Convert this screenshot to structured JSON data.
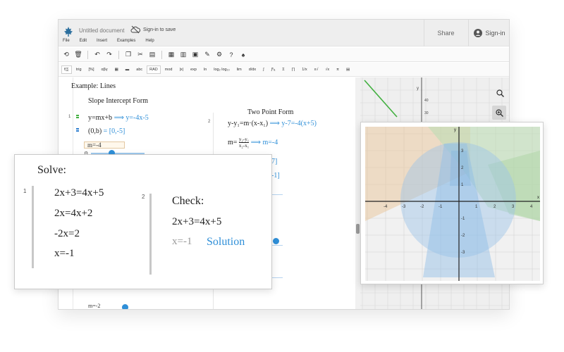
{
  "app": {
    "doc_title": "Untitled document",
    "signin_save": "Sign-in to save",
    "share": "Share",
    "signin": "Sign-in",
    "menu": [
      "File",
      "Edit",
      "Insert",
      "Examples",
      "Help"
    ],
    "math_toolbar": [
      "f|∑",
      "trig",
      "[%]",
      "αβγ",
      "abc",
      "RAD",
      "mod",
      "|x|",
      "exp",
      "ln",
      "log₂ log₁₀",
      "lim",
      "d/dx",
      "∫",
      "∫ᵇₐ",
      "Σ",
      "∏",
      "1/x",
      "x√",
      "√x",
      "π"
    ]
  },
  "sheet": {
    "example_title": "Example: Lines",
    "slope_heading": "Slope Intercept Form",
    "two_point_heading": "Two Point Form",
    "block1_number": "1",
    "block2_number": "2",
    "eq_slope": "y=mx+b",
    "eq_slope_result": "⟹ y=-4x-5",
    "eq_point": "(0,b)",
    "eq_point_result": "= [0,-5]",
    "m_value": "m=-4",
    "eq_two_point": "y-y₁=m·(x-x₁)",
    "eq_two_point_result": "⟹ y-7=-4(x+5)",
    "eq_m_formula_prefix": "m=",
    "eq_m_num": "y₂-y₁",
    "eq_m_den": "x₂-x₁",
    "eq_m_result": "⟹ m=-4",
    "partial_1": "7]",
    "partial_2": "-1]",
    "m_bottom": "m=-2"
  },
  "solve": {
    "title": "Solve:",
    "block1_number": "1",
    "block2_number": "2",
    "steps": [
      "2x+3=4x+5",
      "2x=4x+2",
      "-2x=2",
      "x=-1"
    ],
    "check_title": "Check:",
    "check_eq": "2x+3=4x+5",
    "check_x": "x=-1",
    "solution_label": "Solution"
  },
  "bg_graph": {
    "axis_x": "x",
    "axis_y": "y",
    "y_ticks": [
      "40",
      "30",
      "20",
      "10"
    ]
  },
  "fg_graph": {
    "axis_x": "x",
    "axis_y": "y",
    "x_ticks": [
      "-4",
      "-3",
      "-2",
      "-1",
      "1",
      "2",
      "3",
      "4"
    ],
    "y_ticks": [
      "3",
      "2",
      "1",
      "-1",
      "-2",
      "-3"
    ]
  },
  "colors": {
    "accent_blue": "#2f8fd8",
    "green": "#42b040",
    "orange_region": "#e9c9a0",
    "green_region": "#bcdcb4",
    "blue_region": "#9cc4e8"
  }
}
